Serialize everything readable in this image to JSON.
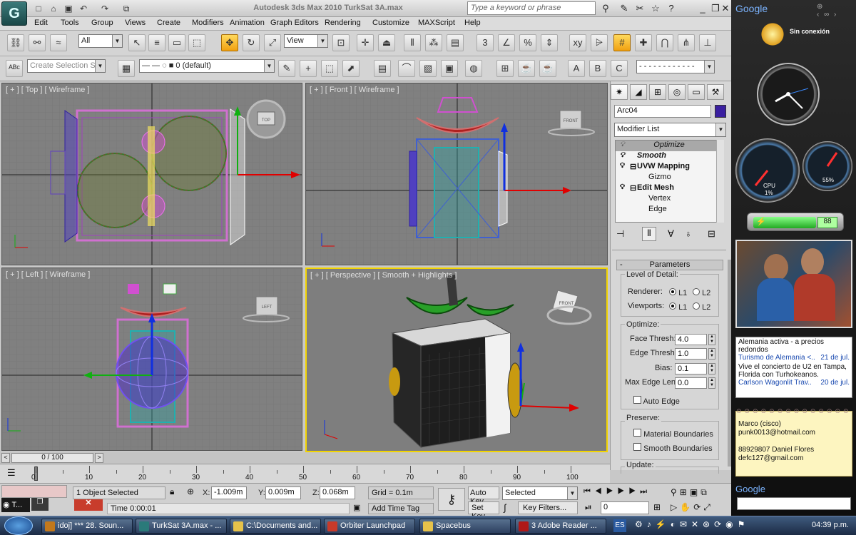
{
  "app": {
    "logo": "G",
    "title": "Autodesk 3ds Max  2010     TurkSat 3A.max",
    "search_placeholder": "Type a keyword or phrase"
  },
  "menu": [
    "Edit",
    "Tools",
    "Group",
    "Views",
    "Create",
    "Modifiers",
    "Animation",
    "Graph Editors",
    "Rendering",
    "Customize",
    "MAXScript",
    "Help"
  ],
  "toolbar": {
    "selection_filter": "All",
    "reference_coord": "View",
    "named_selection": "Create Selection Se",
    "layer": "0 (default)",
    "snaps_label": "3",
    "percent_label": "%"
  },
  "viewports": {
    "top": "[ + ] [ Top ] [ Wireframe ]",
    "front": "[ + ] [ Front ] [ Wireframe ]",
    "left": "[ + ] [ Left ] [ Wireframe ]",
    "perspective": "[ + ] [ Perspective ] [ Smooth + Highlights ]",
    "viewcube": {
      "top": "TOP",
      "front": "FRONT",
      "left": "LEFT"
    }
  },
  "command_panel": {
    "object_name": "Arc04",
    "modifier_list": "Modifier List",
    "stack": [
      {
        "label": "Optimize",
        "selected": true
      },
      {
        "label": "Smooth",
        "bold": true
      },
      {
        "label": "UVW Mapping",
        "bold": true
      },
      {
        "label": "Gizmo",
        "sub": true
      },
      {
        "label": "Edit Mesh",
        "bold": true
      },
      {
        "label": "Vertex",
        "sub": true
      },
      {
        "label": "Edge",
        "sub": true
      }
    ],
    "parameters_title": "Parameters",
    "level_of_detail": "Level of Detail:",
    "renderer_label": "Renderer:",
    "viewports_label": "Viewports:",
    "l1": "L1",
    "l2": "L2",
    "optimize_label": "Optimize:",
    "face_thresh_label": "Face Thresh:",
    "face_thresh": "4.0",
    "edge_thresh_label": "Edge Thresh:",
    "edge_thresh": "1.0",
    "bias_label": "Bias:",
    "bias": "0.1",
    "max_edge_label": "Max Edge Len:",
    "max_edge": "0.0",
    "auto_edge": "Auto Edge",
    "preserve_label": "Preserve:",
    "material_boundaries": "Material Boundaries",
    "smooth_boundaries": "Smooth Boundaries",
    "update_label": "Update:"
  },
  "timeline": {
    "frame": "0 / 100",
    "ticks": [
      "0",
      "10",
      "20",
      "30",
      "40",
      "50",
      "60",
      "70",
      "80",
      "90",
      "100"
    ]
  },
  "status": {
    "selected": "1 Object Selected",
    "x_label": "X:",
    "x": "-1.009m",
    "y_label": "Y:",
    "y": "0.009m",
    "z_label": "Z:",
    "z": "0.068m",
    "grid": "Grid = 0.1m",
    "time": "Time  0:00:01",
    "add_time_tag": "Add Time Tag",
    "auto_key": "Auto Key",
    "set_key": "Set Key",
    "key_mode": "Selected",
    "key_filters": "Key Filters...",
    "frame_field": "0",
    "mini_t": "T..."
  },
  "taskbar": {
    "items": [
      {
        "label": "idoj] *** 28. Soun...",
        "color": "#c2781c"
      },
      {
        "label": "TurkSat 3A.max - ...",
        "color": "#2b7a7a"
      },
      {
        "label": "C:\\Documents and...",
        "color": "#e6c24a"
      },
      {
        "label": "Orbiter Launchpad",
        "color": "#c83a2a"
      },
      {
        "label": "Spacebus",
        "color": "#e6c24a"
      },
      {
        "label": "3 Adobe Reader ...",
        "color": "#b01818"
      }
    ],
    "lang": "ES",
    "clock": "04:39 p.m."
  },
  "sidebar": {
    "google_label": "Google",
    "weather": "Sin conexión",
    "cpu_label": "CPU",
    "cpu": "1%",
    "mem": "55%",
    "battery": "88",
    "news": [
      {
        "title": "Alemania activa - a precios redondos",
        "source": "Turismo de Alemania <..",
        "date": "21 de jul."
      },
      {
        "title": "Vive el concierto de U2 en Tampa, Florida con Turhokeanos.",
        "source": "Carlson Wagonlit Trav..",
        "date": "20 de jul."
      }
    ],
    "note_lines": [
      "Marco (cisco)",
      "punk0013@hotmail.com",
      "",
      "88929807 Daniel Flores",
      "defc127@gmail.com"
    ],
    "google_search_label": "Google"
  }
}
